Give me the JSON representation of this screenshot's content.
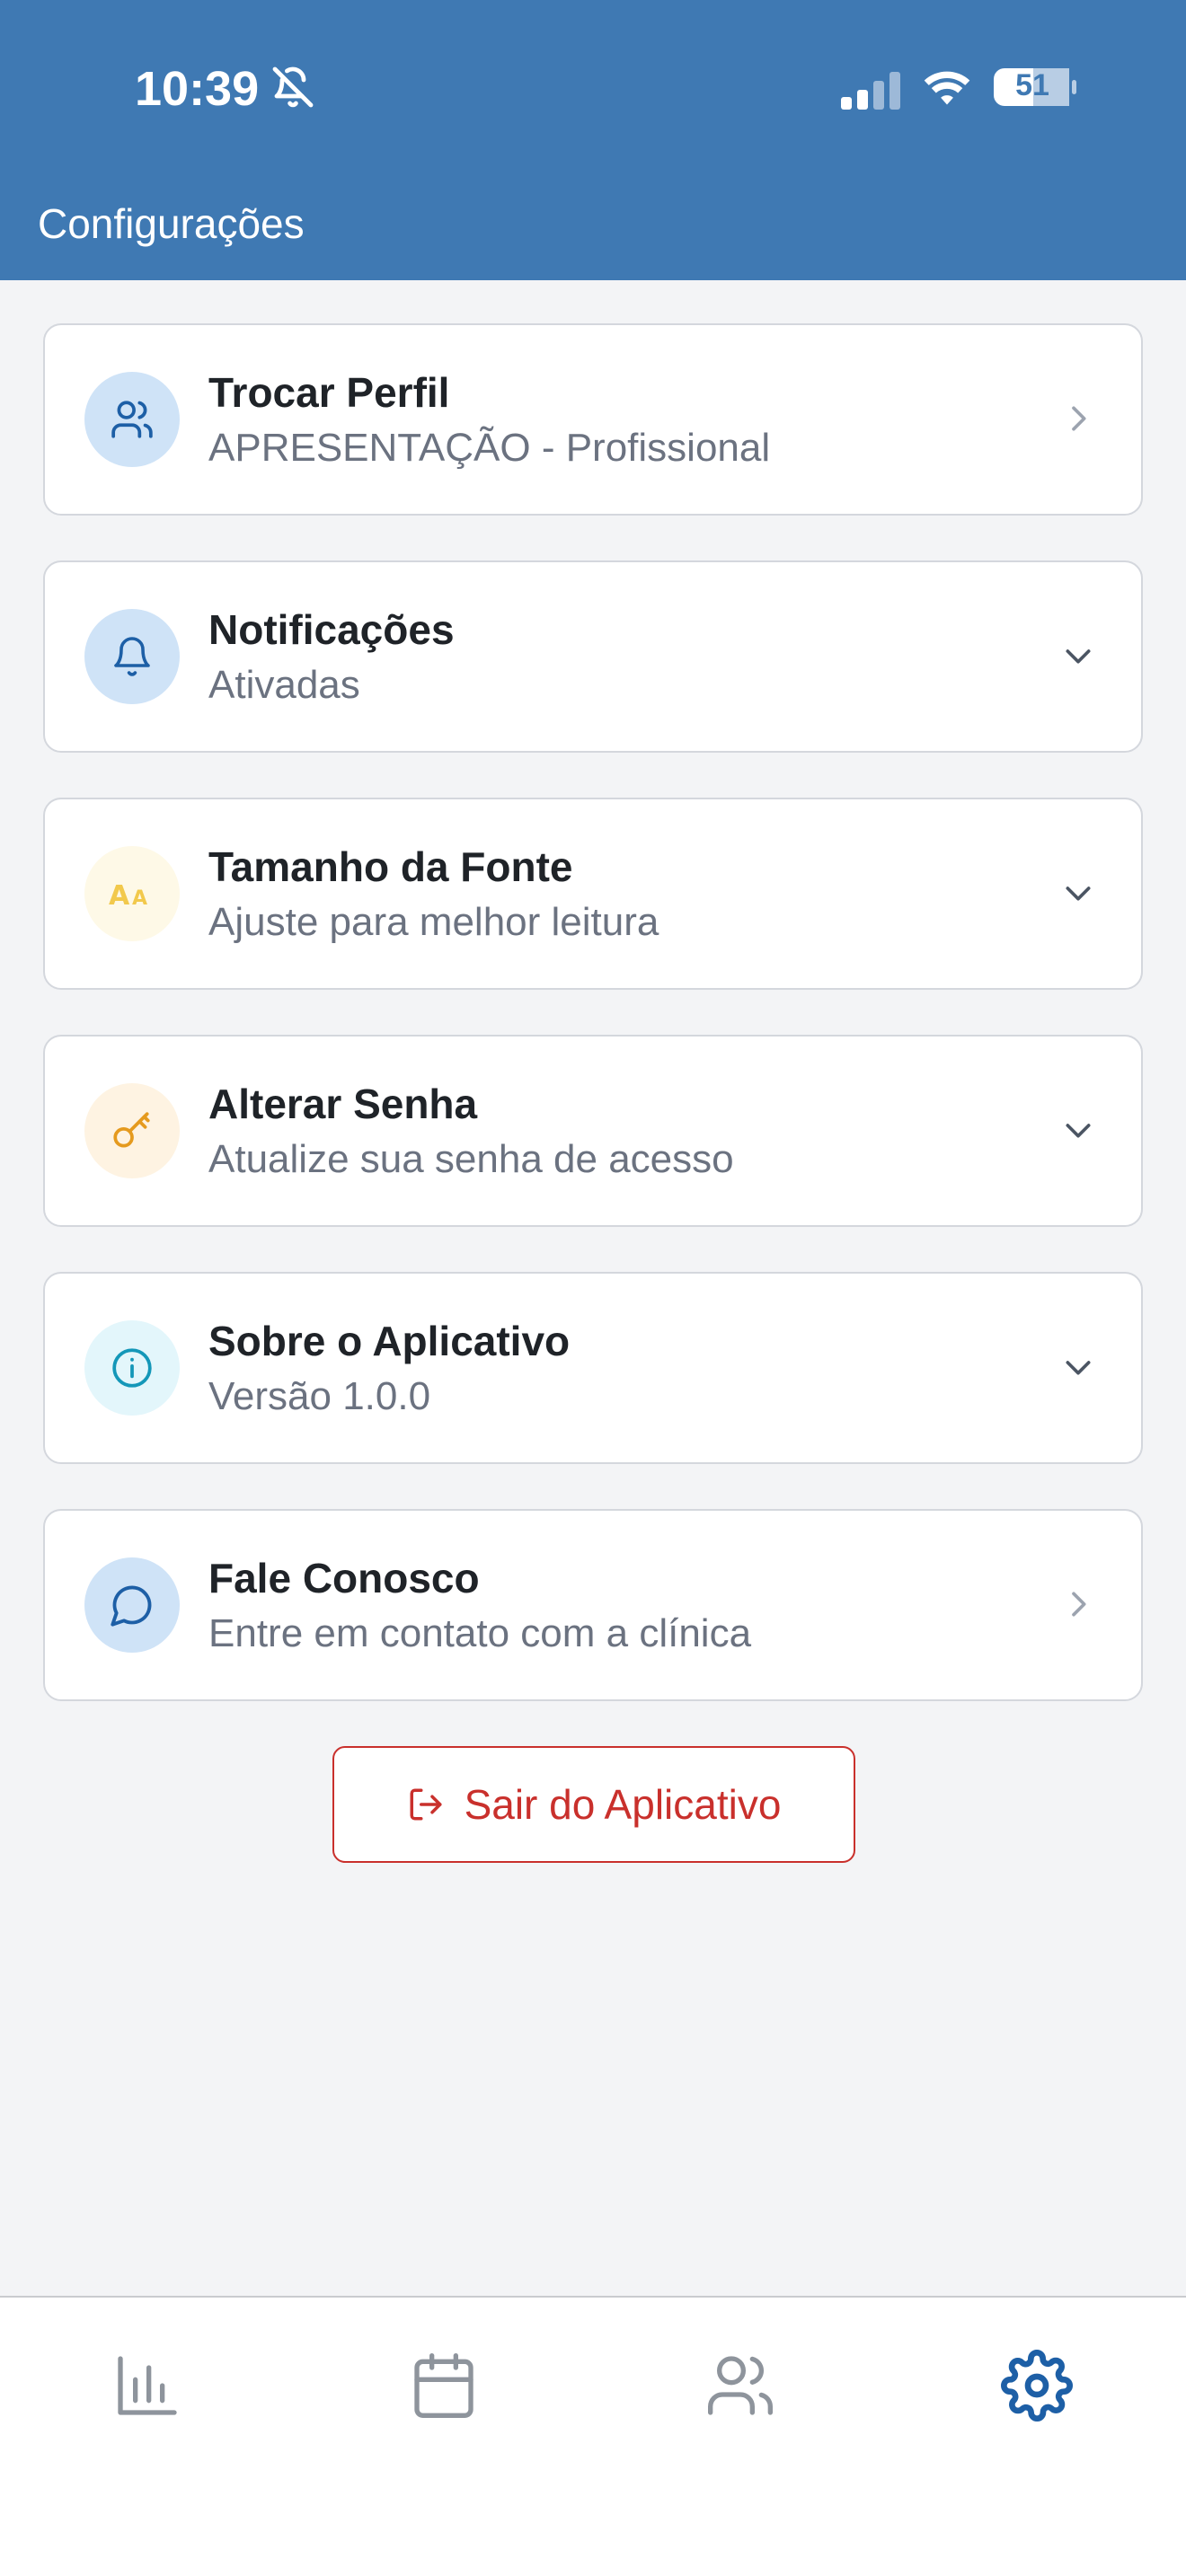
{
  "status_bar": {
    "time": "10:39",
    "battery": "51",
    "icons": [
      "bell-off-icon",
      "signal-icon",
      "wifi-icon",
      "battery-icon"
    ]
  },
  "header": {
    "title": "Configurações",
    "color": "#3F79B3"
  },
  "settings": [
    {
      "title": "Trocar Perfil",
      "subtitle": "APRESENTAÇÃO - Profissional",
      "icon": "users-icon",
      "action": "chevron-right-icon"
    },
    {
      "title": "Notificações",
      "subtitle": "Ativadas",
      "icon": "bell-icon",
      "action": "chevron-down-icon"
    },
    {
      "title": "Tamanho da Fonte",
      "subtitle": "Ajuste para melhor leitura",
      "icon": "font-size-icon",
      "action": "chevron-down-icon"
    },
    {
      "title": "Alterar Senha",
      "subtitle": "Atualize sua senha de acesso",
      "icon": "key-icon",
      "action": "chevron-down-icon"
    },
    {
      "title": "Sobre o Aplicativo",
      "subtitle": "Versão 1.0.0",
      "icon": "info-icon",
      "action": "chevron-down-icon"
    },
    {
      "title": "Fale Conosco",
      "subtitle": "Entre em contato com a clínica",
      "icon": "chat-icon",
      "action": "chevron-right-icon"
    }
  ],
  "logout": {
    "label": "Sair do Aplicativo",
    "icon": "logout-icon",
    "color": "#C9302C"
  },
  "tabbar": {
    "items": [
      "chart-icon",
      "calendar-icon",
      "users-icon",
      "settings-icon"
    ],
    "active": "settings-icon",
    "active_color": "#1D5FA6"
  }
}
